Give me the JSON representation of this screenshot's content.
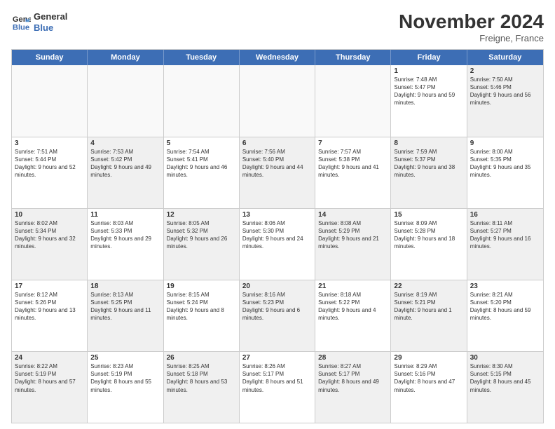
{
  "header": {
    "logo_line1": "General",
    "logo_line2": "Blue",
    "month_title": "November 2024",
    "location": "Freigne, France"
  },
  "days_of_week": [
    "Sunday",
    "Monday",
    "Tuesday",
    "Wednesday",
    "Thursday",
    "Friday",
    "Saturday"
  ],
  "rows": [
    [
      {
        "day": "",
        "info": "",
        "empty": true
      },
      {
        "day": "",
        "info": "",
        "empty": true
      },
      {
        "day": "",
        "info": "",
        "empty": true
      },
      {
        "day": "",
        "info": "",
        "empty": true
      },
      {
        "day": "",
        "info": "",
        "empty": true
      },
      {
        "day": "1",
        "info": "Sunrise: 7:48 AM\nSunset: 5:47 PM\nDaylight: 9 hours and 59 minutes.",
        "empty": false
      },
      {
        "day": "2",
        "info": "Sunrise: 7:50 AM\nSunset: 5:46 PM\nDaylight: 9 hours and 56 minutes.",
        "empty": false,
        "shaded": true
      }
    ],
    [
      {
        "day": "3",
        "info": "Sunrise: 7:51 AM\nSunset: 5:44 PM\nDaylight: 9 hours and 52 minutes.",
        "empty": false
      },
      {
        "day": "4",
        "info": "Sunrise: 7:53 AM\nSunset: 5:42 PM\nDaylight: 9 hours and 49 minutes.",
        "empty": false,
        "shaded": true
      },
      {
        "day": "5",
        "info": "Sunrise: 7:54 AM\nSunset: 5:41 PM\nDaylight: 9 hours and 46 minutes.",
        "empty": false
      },
      {
        "day": "6",
        "info": "Sunrise: 7:56 AM\nSunset: 5:40 PM\nDaylight: 9 hours and 44 minutes.",
        "empty": false,
        "shaded": true
      },
      {
        "day": "7",
        "info": "Sunrise: 7:57 AM\nSunset: 5:38 PM\nDaylight: 9 hours and 41 minutes.",
        "empty": false
      },
      {
        "day": "8",
        "info": "Sunrise: 7:59 AM\nSunset: 5:37 PM\nDaylight: 9 hours and 38 minutes.",
        "empty": false,
        "shaded": true
      },
      {
        "day": "9",
        "info": "Sunrise: 8:00 AM\nSunset: 5:35 PM\nDaylight: 9 hours and 35 minutes.",
        "empty": false
      }
    ],
    [
      {
        "day": "10",
        "info": "Sunrise: 8:02 AM\nSunset: 5:34 PM\nDaylight: 9 hours and 32 minutes.",
        "empty": false,
        "shaded": true
      },
      {
        "day": "11",
        "info": "Sunrise: 8:03 AM\nSunset: 5:33 PM\nDaylight: 9 hours and 29 minutes.",
        "empty": false
      },
      {
        "day": "12",
        "info": "Sunrise: 8:05 AM\nSunset: 5:32 PM\nDaylight: 9 hours and 26 minutes.",
        "empty": false,
        "shaded": true
      },
      {
        "day": "13",
        "info": "Sunrise: 8:06 AM\nSunset: 5:30 PM\nDaylight: 9 hours and 24 minutes.",
        "empty": false
      },
      {
        "day": "14",
        "info": "Sunrise: 8:08 AM\nSunset: 5:29 PM\nDaylight: 9 hours and 21 minutes.",
        "empty": false,
        "shaded": true
      },
      {
        "day": "15",
        "info": "Sunrise: 8:09 AM\nSunset: 5:28 PM\nDaylight: 9 hours and 18 minutes.",
        "empty": false
      },
      {
        "day": "16",
        "info": "Sunrise: 8:11 AM\nSunset: 5:27 PM\nDaylight: 9 hours and 16 minutes.",
        "empty": false,
        "shaded": true
      }
    ],
    [
      {
        "day": "17",
        "info": "Sunrise: 8:12 AM\nSunset: 5:26 PM\nDaylight: 9 hours and 13 minutes.",
        "empty": false
      },
      {
        "day": "18",
        "info": "Sunrise: 8:13 AM\nSunset: 5:25 PM\nDaylight: 9 hours and 11 minutes.",
        "empty": false,
        "shaded": true
      },
      {
        "day": "19",
        "info": "Sunrise: 8:15 AM\nSunset: 5:24 PM\nDaylight: 9 hours and 8 minutes.",
        "empty": false
      },
      {
        "day": "20",
        "info": "Sunrise: 8:16 AM\nSunset: 5:23 PM\nDaylight: 9 hours and 6 minutes.",
        "empty": false,
        "shaded": true
      },
      {
        "day": "21",
        "info": "Sunrise: 8:18 AM\nSunset: 5:22 PM\nDaylight: 9 hours and 4 minutes.",
        "empty": false
      },
      {
        "day": "22",
        "info": "Sunrise: 8:19 AM\nSunset: 5:21 PM\nDaylight: 9 hours and 1 minute.",
        "empty": false,
        "shaded": true
      },
      {
        "day": "23",
        "info": "Sunrise: 8:21 AM\nSunset: 5:20 PM\nDaylight: 8 hours and 59 minutes.",
        "empty": false
      }
    ],
    [
      {
        "day": "24",
        "info": "Sunrise: 8:22 AM\nSunset: 5:19 PM\nDaylight: 8 hours and 57 minutes.",
        "empty": false,
        "shaded": true
      },
      {
        "day": "25",
        "info": "Sunrise: 8:23 AM\nSunset: 5:19 PM\nDaylight: 8 hours and 55 minutes.",
        "empty": false
      },
      {
        "day": "26",
        "info": "Sunrise: 8:25 AM\nSunset: 5:18 PM\nDaylight: 8 hours and 53 minutes.",
        "empty": false,
        "shaded": true
      },
      {
        "day": "27",
        "info": "Sunrise: 8:26 AM\nSunset: 5:17 PM\nDaylight: 8 hours and 51 minutes.",
        "empty": false
      },
      {
        "day": "28",
        "info": "Sunrise: 8:27 AM\nSunset: 5:17 PM\nDaylight: 8 hours and 49 minutes.",
        "empty": false,
        "shaded": true
      },
      {
        "day": "29",
        "info": "Sunrise: 8:29 AM\nSunset: 5:16 PM\nDaylight: 8 hours and 47 minutes.",
        "empty": false
      },
      {
        "day": "30",
        "info": "Sunrise: 8:30 AM\nSunset: 5:15 PM\nDaylight: 8 hours and 45 minutes.",
        "empty": false,
        "shaded": true
      }
    ]
  ]
}
